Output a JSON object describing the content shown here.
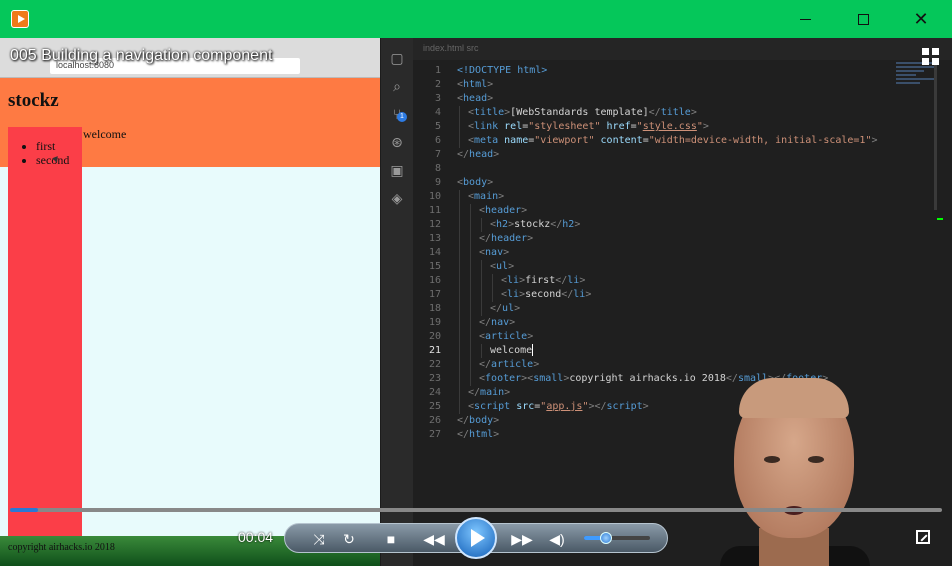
{
  "window": {
    "minimize_glyph": "—",
    "close_glyph": "✕"
  },
  "video": {
    "title": "005 Building a navigation component",
    "elapsed": "00:04",
    "progress_fraction": 0.03,
    "volume_fraction": 0.33
  },
  "browser": {
    "url": "localhost:8080",
    "site_title": "stockz",
    "nav_items": [
      "first",
      "second"
    ],
    "article_text": "welcome",
    "footer_text": "copyright airhacks.io 2018"
  },
  "editor": {
    "tab_label": "index.html  src",
    "active_line": 21,
    "scm_badge": "1",
    "lines": [
      {
        "n": "1",
        "indent": 0,
        "tokens": [
          [
            "t-doctype",
            "<!DOCTYPE html>"
          ]
        ]
      },
      {
        "n": "2",
        "indent": 0,
        "tokens": [
          [
            "t-punct",
            "<"
          ],
          [
            "t-tag",
            "html"
          ],
          [
            "t-punct",
            ">"
          ]
        ]
      },
      {
        "n": "3",
        "indent": 0,
        "tokens": [
          [
            "t-punct",
            "<"
          ],
          [
            "t-tag",
            "head"
          ],
          [
            "t-punct",
            ">"
          ]
        ]
      },
      {
        "n": "4",
        "indent": 1,
        "tokens": [
          [
            "t-punct",
            "<"
          ],
          [
            "t-tag",
            "title"
          ],
          [
            "t-punct",
            ">"
          ],
          [
            "",
            "[WebStandards template]"
          ],
          [
            "t-punct",
            "</"
          ],
          [
            "t-tag",
            "title"
          ],
          [
            "t-punct",
            ">"
          ]
        ]
      },
      {
        "n": "5",
        "indent": 1,
        "tokens": [
          [
            "t-punct",
            "<"
          ],
          [
            "t-tag",
            "link"
          ],
          [
            "",
            " "
          ],
          [
            "t-attr",
            "rel"
          ],
          [
            "",
            "="
          ],
          [
            "t-str",
            "\"stylesheet\""
          ],
          [
            "",
            " "
          ],
          [
            "t-attr",
            "href"
          ],
          [
            "",
            "="
          ],
          [
            "t-str",
            "\""
          ],
          [
            "t-str t-link",
            "style.css"
          ],
          [
            "t-str",
            "\""
          ],
          [
            "t-punct",
            ">"
          ]
        ]
      },
      {
        "n": "6",
        "indent": 1,
        "tokens": [
          [
            "t-punct",
            "<"
          ],
          [
            "t-tag",
            "meta"
          ],
          [
            "",
            " "
          ],
          [
            "t-attr",
            "name"
          ],
          [
            "",
            "="
          ],
          [
            "t-str",
            "\"viewport\""
          ],
          [
            "",
            " "
          ],
          [
            "t-attr",
            "content"
          ],
          [
            "",
            "="
          ],
          [
            "t-str",
            "\"width=device-width, initial-scale=1\""
          ],
          [
            "t-punct",
            ">"
          ]
        ]
      },
      {
        "n": "7",
        "indent": 0,
        "tokens": [
          [
            "t-punct",
            "</"
          ],
          [
            "t-tag",
            "head"
          ],
          [
            "t-punct",
            ">"
          ]
        ]
      },
      {
        "n": "8",
        "indent": 0,
        "tokens": []
      },
      {
        "n": "9",
        "indent": 0,
        "tokens": [
          [
            "t-punct",
            "<"
          ],
          [
            "t-tag",
            "body"
          ],
          [
            "t-punct",
            ">"
          ]
        ]
      },
      {
        "n": "10",
        "indent": 1,
        "tokens": [
          [
            "t-punct",
            "<"
          ],
          [
            "t-tag",
            "main"
          ],
          [
            "t-punct",
            ">"
          ]
        ]
      },
      {
        "n": "11",
        "indent": 2,
        "tokens": [
          [
            "t-punct",
            "<"
          ],
          [
            "t-tag",
            "header"
          ],
          [
            "t-punct",
            ">"
          ]
        ]
      },
      {
        "n": "12",
        "indent": 3,
        "tokens": [
          [
            "t-punct",
            "<"
          ],
          [
            "t-tag",
            "h2"
          ],
          [
            "t-punct",
            ">"
          ],
          [
            "",
            "stockz"
          ],
          [
            "t-punct",
            "</"
          ],
          [
            "t-tag",
            "h2"
          ],
          [
            "t-punct",
            ">"
          ]
        ]
      },
      {
        "n": "13",
        "indent": 2,
        "tokens": [
          [
            "t-punct",
            "</"
          ],
          [
            "t-tag",
            "header"
          ],
          [
            "t-punct",
            ">"
          ]
        ]
      },
      {
        "n": "14",
        "indent": 2,
        "tokens": [
          [
            "t-punct",
            "<"
          ],
          [
            "t-tag",
            "nav"
          ],
          [
            "t-punct",
            ">"
          ]
        ]
      },
      {
        "n": "15",
        "indent": 3,
        "tokens": [
          [
            "t-punct",
            "<"
          ],
          [
            "t-tag",
            "ul"
          ],
          [
            "t-punct",
            ">"
          ]
        ]
      },
      {
        "n": "16",
        "indent": 4,
        "tokens": [
          [
            "t-punct",
            "<"
          ],
          [
            "t-tag",
            "li"
          ],
          [
            "t-punct",
            ">"
          ],
          [
            "",
            "first"
          ],
          [
            "t-punct",
            "</"
          ],
          [
            "t-tag",
            "li"
          ],
          [
            "t-punct",
            ">"
          ]
        ]
      },
      {
        "n": "17",
        "indent": 4,
        "tokens": [
          [
            "t-punct",
            "<"
          ],
          [
            "t-tag",
            "li"
          ],
          [
            "t-punct",
            ">"
          ],
          [
            "",
            "second"
          ],
          [
            "t-punct",
            "</"
          ],
          [
            "t-tag",
            "li"
          ],
          [
            "t-punct",
            ">"
          ]
        ]
      },
      {
        "n": "18",
        "indent": 3,
        "tokens": [
          [
            "t-punct",
            "</"
          ],
          [
            "t-tag",
            "ul"
          ],
          [
            "t-punct",
            ">"
          ]
        ]
      },
      {
        "n": "19",
        "indent": 2,
        "tokens": [
          [
            "t-punct",
            "</"
          ],
          [
            "t-tag",
            "nav"
          ],
          [
            "t-punct",
            ">"
          ]
        ]
      },
      {
        "n": "20",
        "indent": 2,
        "tokens": [
          [
            "t-punct",
            "<"
          ],
          [
            "t-tag",
            "article"
          ],
          [
            "t-punct",
            ">"
          ]
        ]
      },
      {
        "n": "21",
        "indent": 3,
        "tokens": [
          [
            "",
            "welcome"
          ]
        ]
      },
      {
        "n": "22",
        "indent": 2,
        "tokens": [
          [
            "t-punct",
            "</"
          ],
          [
            "t-tag",
            "article"
          ],
          [
            "t-punct",
            ">"
          ]
        ]
      },
      {
        "n": "23",
        "indent": 2,
        "tokens": [
          [
            "t-punct",
            "<"
          ],
          [
            "t-tag",
            "footer"
          ],
          [
            "t-punct",
            "><"
          ],
          [
            "t-tag",
            "small"
          ],
          [
            "t-punct",
            ">"
          ],
          [
            "",
            "copyright airhacks.io 2018"
          ],
          [
            "t-punct",
            "</"
          ],
          [
            "t-tag",
            "small"
          ],
          [
            "t-punct",
            "></"
          ],
          [
            "t-tag",
            "footer"
          ],
          [
            "t-punct",
            ">"
          ]
        ]
      },
      {
        "n": "24",
        "indent": 1,
        "tokens": [
          [
            "t-punct",
            "</"
          ],
          [
            "t-tag",
            "main"
          ],
          [
            "t-punct",
            ">"
          ]
        ]
      },
      {
        "n": "25",
        "indent": 1,
        "tokens": [
          [
            "t-punct",
            "<"
          ],
          [
            "t-tag",
            "script"
          ],
          [
            "",
            " "
          ],
          [
            "t-attr",
            "src"
          ],
          [
            "",
            "="
          ],
          [
            "t-str",
            "\""
          ],
          [
            "t-str t-link",
            "app.js"
          ],
          [
            "t-str",
            "\""
          ],
          [
            "t-punct",
            "></"
          ],
          [
            "t-tag",
            "script"
          ],
          [
            "t-punct",
            ">"
          ]
        ]
      },
      {
        "n": "26",
        "indent": 0,
        "tokens": [
          [
            "t-punct",
            "</"
          ],
          [
            "t-tag",
            "body"
          ],
          [
            "t-punct",
            ">"
          ]
        ]
      },
      {
        "n": "27",
        "indent": 0,
        "tokens": [
          [
            "t-punct",
            "</"
          ],
          [
            "t-tag",
            "html"
          ],
          [
            "t-punct",
            ">"
          ]
        ]
      }
    ]
  },
  "icons": {
    "app": "media-player-icon",
    "activity": [
      "files-icon",
      "search-icon",
      "source-control-icon",
      "debug-icon",
      "extensions-icon",
      "docker-icon"
    ],
    "controls": [
      "shuffle-icon",
      "repeat-icon",
      "stop-icon",
      "previous-icon",
      "play-icon",
      "next-icon",
      "volume-icon",
      "fullscreen-icon"
    ]
  }
}
